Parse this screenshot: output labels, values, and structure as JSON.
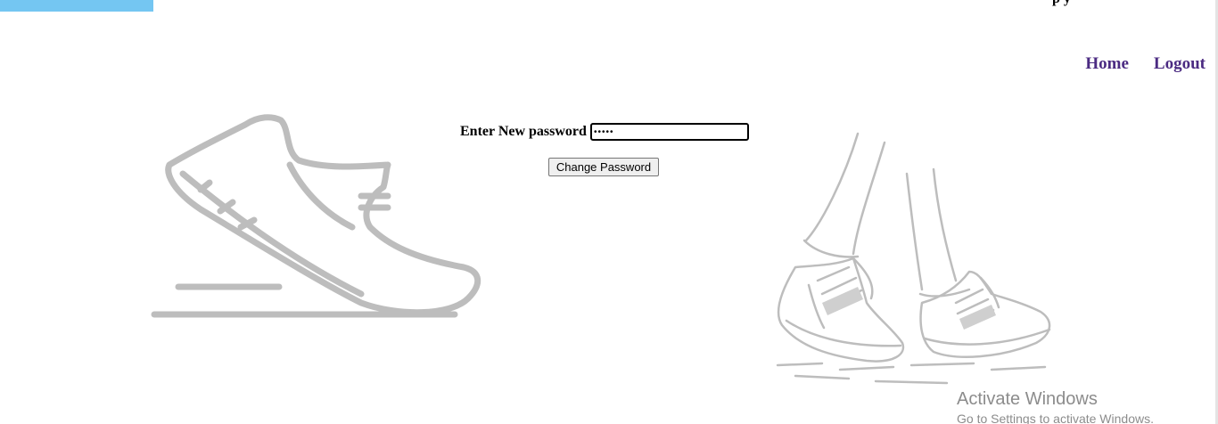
{
  "header": {
    "clipped_text": "p y",
    "nav": {
      "home": "Home",
      "logout": "Logout"
    }
  },
  "form": {
    "label": "Enter New password",
    "password_value": "•••••",
    "submit_label": "Change Password"
  },
  "watermark": {
    "line1": "Activate Windows",
    "line2": "Go to Settings to activate Windows."
  },
  "colors": {
    "accent_bar": "#74c6f2",
    "nav_link": "#4b2b82",
    "illustration": "#bdbdbd"
  },
  "icons": {
    "left_illustration": "running-shoe-icon",
    "right_illustration": "walking-sneakers-illustration"
  }
}
